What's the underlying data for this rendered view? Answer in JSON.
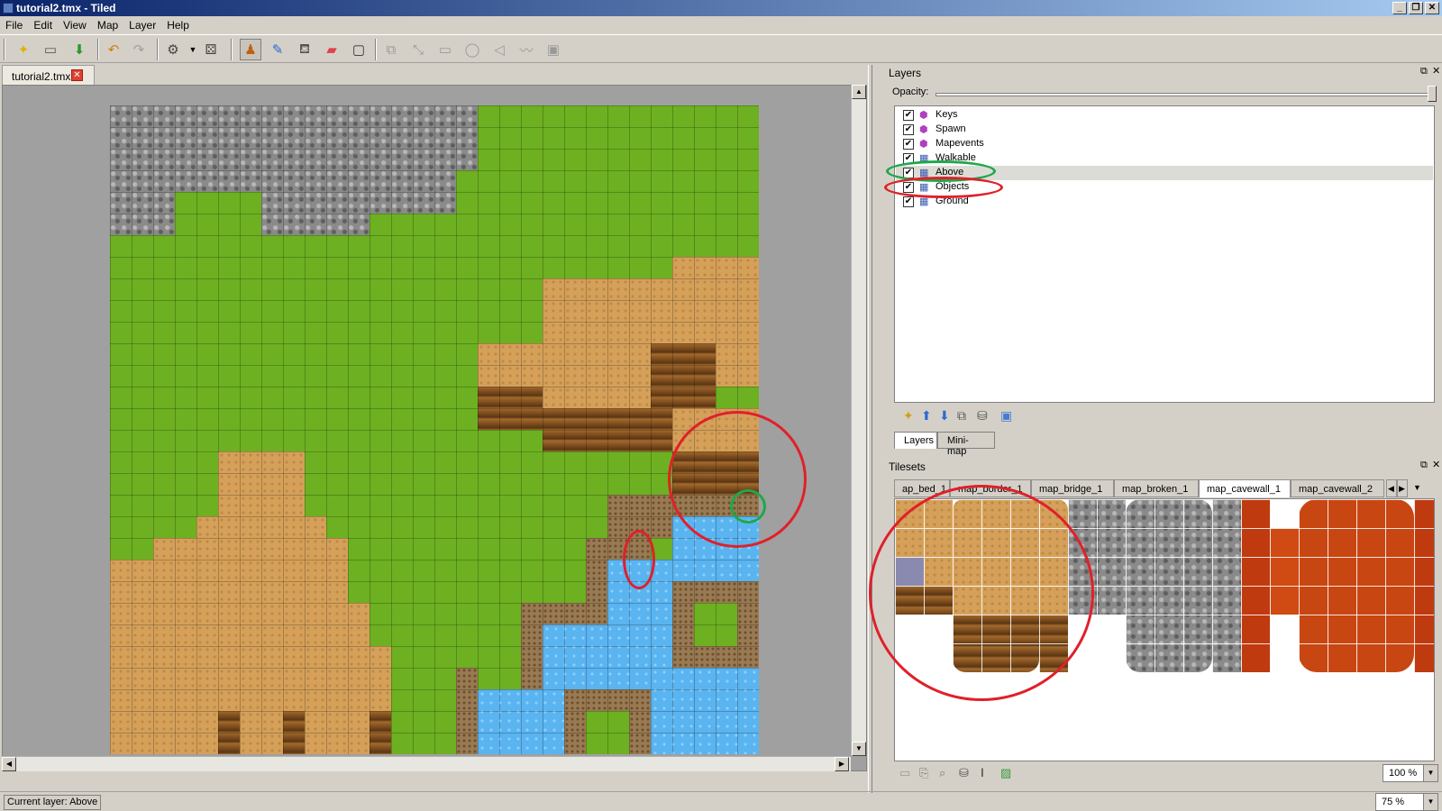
{
  "window": {
    "title": "tutorial2.tmx - Tiled",
    "controls": {
      "minimize": "_",
      "maximize": "❐",
      "close": "✕"
    }
  },
  "menu": [
    "File",
    "Edit",
    "View",
    "Map",
    "Layer",
    "Help"
  ],
  "toolbar_icons": [
    "new-file",
    "open-file",
    "save",
    "undo",
    "redo",
    "random-mode",
    "random-dice",
    "stamp-brush",
    "terrain-brush",
    "bucket-fill",
    "eraser",
    "rect-select",
    "select-objects",
    "edit-polygons",
    "insert-rectangle",
    "insert-ellipse",
    "insert-polygon",
    "insert-polyline",
    "insert-tile"
  ],
  "document": {
    "tab_label": "tutorial2.tmx",
    "close": "✕"
  },
  "layers_panel": {
    "title": "Layers",
    "opacity_label": "Opacity:",
    "opacity": 1.0,
    "layers": [
      {
        "name": "Keys",
        "type": "object",
        "visible": true
      },
      {
        "name": "Spawn",
        "type": "object",
        "visible": true
      },
      {
        "name": "Mapevents",
        "type": "object",
        "visible": true
      },
      {
        "name": "Walkable",
        "type": "tile",
        "visible": true
      },
      {
        "name": "Above",
        "type": "tile",
        "visible": true,
        "selected": true
      },
      {
        "name": "Objects",
        "type": "tile",
        "visible": true
      },
      {
        "name": "Ground",
        "type": "tile",
        "visible": true
      }
    ],
    "tabs": [
      "Layers",
      "Mini-map"
    ],
    "active_tab": "Layers"
  },
  "tilesets_panel": {
    "title": "Tilesets",
    "tabs": [
      "ap_bed_1",
      "map_border_1",
      "map_bridge_1",
      "map_broken_1",
      "map_cavewall_1",
      "map_cavewall_2"
    ],
    "active_tab": "map_cavewall_1",
    "zoom": "100 %"
  },
  "map_zoom": "75 %",
  "status": {
    "current_layer": "Current layer: Above"
  },
  "annotation_colors": {
    "red": "#e0202a",
    "green": "#1ea84a"
  }
}
